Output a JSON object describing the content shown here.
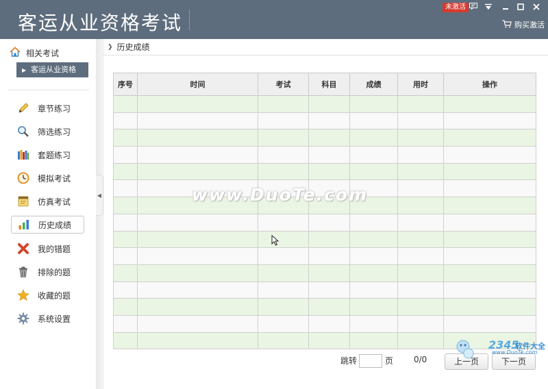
{
  "app": {
    "title": "客运从业资格考试",
    "badge": "未激活",
    "buy_label": "购买激活"
  },
  "sidebar": {
    "home_label": "相关考试",
    "sub_item": "客运从业资格",
    "items": [
      {
        "label": "章节练习",
        "icon": "pencil-icon"
      },
      {
        "label": "筛选练习",
        "icon": "magnifier-icon"
      },
      {
        "label": "套题练习",
        "icon": "books-icon"
      },
      {
        "label": "模拟考试",
        "icon": "clock-icon"
      },
      {
        "label": "仿真考试",
        "icon": "notepad-icon"
      },
      {
        "label": "历史成绩",
        "icon": "bar-chart-icon",
        "active": true
      },
      {
        "label": "我的错题",
        "icon": "cross-icon"
      },
      {
        "label": "排除的题",
        "icon": "trash-icon"
      },
      {
        "label": "收藏的题",
        "icon": "star-icon"
      },
      {
        "label": "系统设置",
        "icon": "gear-icon"
      }
    ]
  },
  "breadcrumb": "历史成绩",
  "table": {
    "columns": [
      "序号",
      "时间",
      "考试",
      "科目",
      "成绩",
      "用时",
      "操作"
    ],
    "rows": []
  },
  "pager": {
    "jump_label": "跳转",
    "page_unit": "页",
    "jump_value": "",
    "count": "0/0",
    "prev_label": "上一页",
    "next_label": "下一页"
  },
  "watermark": {
    "text": "www.DuoTe.com",
    "logo_number": "2345",
    "logo_text": "软件大全",
    "logo_url": "www.DuoTe.com"
  },
  "colors": {
    "titlebar": "#5e6d7d",
    "row_green": "#eaf5e3",
    "row_gray": "#f9f9f9",
    "badge": "#d63a2e"
  }
}
